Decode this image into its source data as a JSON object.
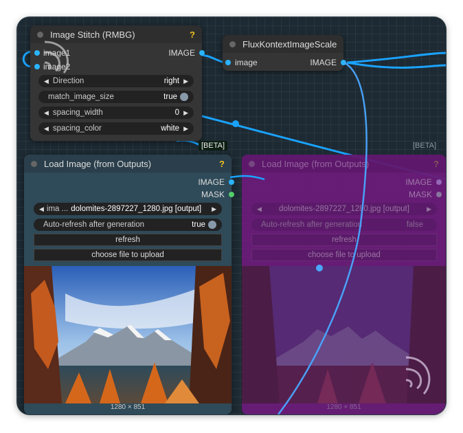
{
  "stitch_node": {
    "title": "Image Stitch (RMBG)",
    "help_badge": "?",
    "inputs": [
      "image1",
      "image2"
    ],
    "output": "IMAGE",
    "widgets": {
      "direction": {
        "label": "Direction",
        "value": "right"
      },
      "match_size": {
        "label": "match_image_size",
        "value": "true"
      },
      "spacing_width": {
        "label": "spacing_width",
        "value": "0"
      },
      "spacing_color": {
        "label": "spacing_color",
        "value": "white"
      }
    }
  },
  "flux_node": {
    "title": "FluxKontextImageScale",
    "input": "image",
    "output": "IMAGE"
  },
  "load_node": {
    "beta": "[BETA]",
    "title": "Load Image (from Outputs)",
    "help_badge": "?",
    "outputs": [
      "IMAGE",
      "MASK"
    ],
    "image_widget": {
      "prefix": "ima ...",
      "value": "dolomites-2897227_1280.jpg [output]"
    },
    "autorefresh": {
      "label": "Auto-refresh after generation",
      "value": "true"
    },
    "refresh_label": "refresh",
    "upload_label": "choose file to upload",
    "dimensions": "1280 × 851"
  },
  "ghost_node": {
    "beta": "[BETA]",
    "title": "Load Image (from Outputs)",
    "help_badge": "?",
    "outputs": [
      "IMAGE",
      "MASK"
    ],
    "image_widget": {
      "value": "dolomites-2897227_1280.jpg [output]"
    },
    "autorefresh": {
      "label": "Auto-refresh after generation",
      "value": "false"
    },
    "refresh_label": "refresh",
    "upload_label": "choose file to upload",
    "dimensions": "1280 × 851"
  },
  "colors": {
    "wire": "#1aa3ff",
    "ghost_overlay": "#8a1fa0",
    "badge": "#f2c020",
    "mask_port": "#55cc6c"
  }
}
